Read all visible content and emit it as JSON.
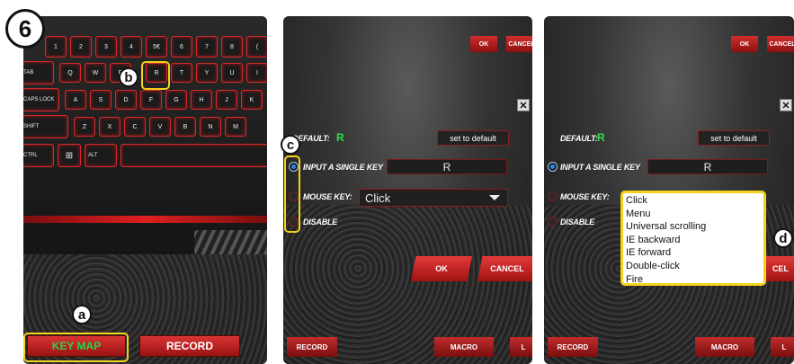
{
  "step_number": "6",
  "callouts": {
    "a": "a",
    "b": "b",
    "c": "c",
    "d": "d"
  },
  "panel1": {
    "keys_row1": [
      "!",
      "@",
      "#",
      "$",
      "%",
      "^",
      "&",
      "*",
      "("
    ],
    "keys_row1_sub": [
      "1",
      "2",
      "3",
      "4",
      "5€",
      "6",
      "7",
      "8"
    ],
    "keys_row2": [
      "Q",
      "W",
      "E",
      "R",
      "T",
      "Y",
      "U",
      "I"
    ],
    "keys_row3": [
      "A",
      "S",
      "D",
      "F",
      "G",
      "H",
      "J",
      "K"
    ],
    "keys_row4": [
      "Z",
      "X",
      "C",
      "V",
      "B",
      "N",
      "M"
    ],
    "tab_label": "TAB",
    "caps_label": "CAPS LOCK",
    "shift_label": "SHIFT",
    "ctrl_label": "CTRL",
    "alt_label": "ALT",
    "key_map_button": "KEY MAP",
    "record_button": "RECORD"
  },
  "dialog": {
    "top_ok": "OK",
    "top_cancel": "CANCEL",
    "close": "✕",
    "default_label": "DEFAULT:",
    "default_value": "R",
    "set_to_default": "set to default",
    "input_single_key_label": "INPUT A SINGLE KEY",
    "input_single_key_value": "R",
    "mouse_key_label": "MOUSE KEY:",
    "mouse_key_value": "Click",
    "disable_label": "DISABLE",
    "ok": "OK",
    "cancel": "CANCEL",
    "bottom_record": "RECORD",
    "bottom_macro": "MACRO",
    "bottom_l": "L",
    "partial_ok": "OK",
    "partial_cancel": "CEL"
  },
  "mouse_key_options": [
    "Click",
    "Menu",
    "Universal scrolling",
    "IE backward",
    "IE forward",
    "Double-click",
    "Fire"
  ],
  "colors": {
    "accent_red": "#d42a2a",
    "highlight_yellow": "#f2d21b",
    "green_value": "#2ee04a",
    "radio_blue": "#2e86e6"
  }
}
